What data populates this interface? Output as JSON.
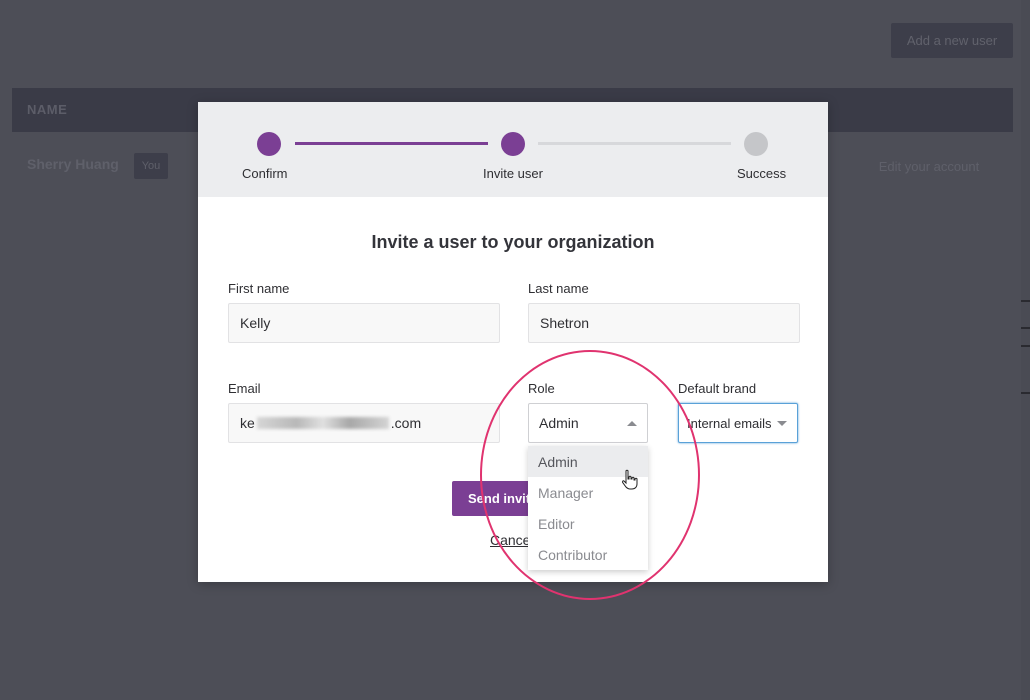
{
  "background": {
    "add_user_label": "Add a new user",
    "table_header": {
      "name_col": "NAME"
    },
    "user_row": {
      "name": "Sherry Huang",
      "badge": "You",
      "edit_label": "Edit your account"
    }
  },
  "stepper": {
    "steps": [
      {
        "label": "Confirm",
        "state": "done"
      },
      {
        "label": "Invite user",
        "state": "current"
      },
      {
        "label": "Success",
        "state": "todo"
      }
    ],
    "accent": "#7b3f94"
  },
  "form": {
    "title": "Invite a user to your organization",
    "first_name": {
      "label": "First name",
      "value": "Kelly"
    },
    "last_name": {
      "label": "Last name",
      "value": "Shetron"
    },
    "email": {
      "label": "Email",
      "value_prefix": "ke",
      "value_suffix": ".com"
    },
    "role": {
      "label": "Role",
      "value": "Admin",
      "options": [
        "Admin",
        "Manager",
        "Editor",
        "Contributor"
      ]
    },
    "default_brand": {
      "label": "Default brand",
      "value": "Internal emails"
    },
    "send_label": "Send invitation",
    "cancel_label": "Cancel"
  },
  "annotation_color": "#e0336f"
}
